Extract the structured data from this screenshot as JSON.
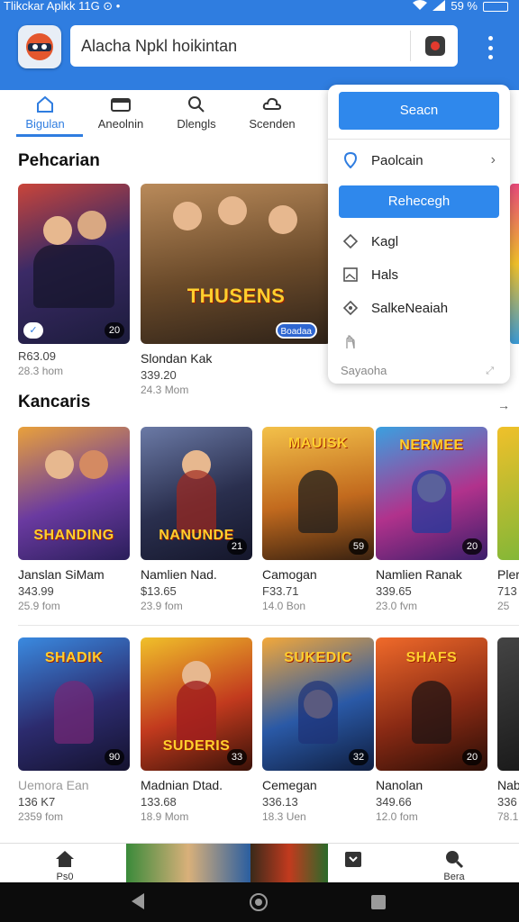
{
  "status": {
    "left": "Tlikckar Aplkk  11G  ⊙ •",
    "battery": "59 %"
  },
  "search": {
    "value": "Alacha Npkl hoikintan"
  },
  "tabs": [
    {
      "label": "Bigulan",
      "icon": "home-icon"
    },
    {
      "label": "Aneolnin",
      "icon": "card-icon"
    },
    {
      "label": "Dlengls",
      "icon": "search-icon"
    },
    {
      "label": "Scenden",
      "icon": "cloud-icon"
    }
  ],
  "sections": {
    "first": "Pehcarian",
    "second": "Kancaris"
  },
  "featured": [
    {
      "title": "R63.09",
      "price": "28.3 hom",
      "size": "",
      "badge": "20",
      "color": "#3b2a66"
    },
    {
      "title": "Slondan Kak",
      "price": "339.20",
      "size": "24.3 Mom",
      "badge": "Boadaa",
      "art": "THUSENS",
      "color": "#6a4a2a"
    }
  ],
  "row1": [
    {
      "title": "Janslan SiMam",
      "price": "343.99",
      "size": "25.9 fom",
      "badge": "",
      "art": "SHANDING",
      "color": "#6a3aa0"
    },
    {
      "title": "Namlien Nad.",
      "price": "$13.65",
      "size": "23.9 fom",
      "badge": "21",
      "art": "NANUNDE",
      "color": "#2a2f4e"
    },
    {
      "title": "Camogan",
      "price": "F33.71",
      "size": "14.0 Bon",
      "badge": "59",
      "art": "MAUISK",
      "color": "#c26a1e"
    },
    {
      "title": "Namlien Ranak",
      "price": "339.65",
      "size": "23.0 fvm",
      "badge": "20",
      "art": "NERMEE",
      "color": "#b1328c"
    },
    {
      "title": "Pler",
      "price": "713",
      "size": "25",
      "badge": "",
      "art": "",
      "color": "#6bb53a"
    }
  ],
  "row2": [
    {
      "title": "Uemora Ean",
      "price": "136 K7",
      "size": "2359 fom",
      "badge": "90",
      "art": "SHADIK",
      "color": "#2c2b6e"
    },
    {
      "title": "Madnian Dtad.",
      "price": "133.68",
      "size": "18.9 Mom",
      "badge": "33",
      "art": "SUDERIS",
      "color": "#c23a1e"
    },
    {
      "title": "Cemegan",
      "price": "336.13",
      "size": "18.3 Uen",
      "badge": "32",
      "art": "SUKEDIC",
      "color": "#2a59a6"
    },
    {
      "title": "Nanolan",
      "price": "349.66",
      "size": "12.0 fom",
      "badge": "20",
      "art": "SHAFS",
      "color": "#8a2a14"
    },
    {
      "title": "Nab",
      "price": "336",
      "size": "78.1",
      "badge": "",
      "art": "",
      "color": "#333"
    }
  ],
  "menu": {
    "primary": "Seacn",
    "item1": "Paolcain",
    "secondary": "Rehecegh",
    "item2": "Kagl",
    "item3": "Hals",
    "item4": "SalkeNeaiah",
    "footer": "Sayaoha"
  },
  "bottomnav": {
    "left": "Ps0",
    "right": "Bera"
  },
  "colors": {
    "brand": "#2f7de0",
    "menu_button": "#2f88ec"
  }
}
